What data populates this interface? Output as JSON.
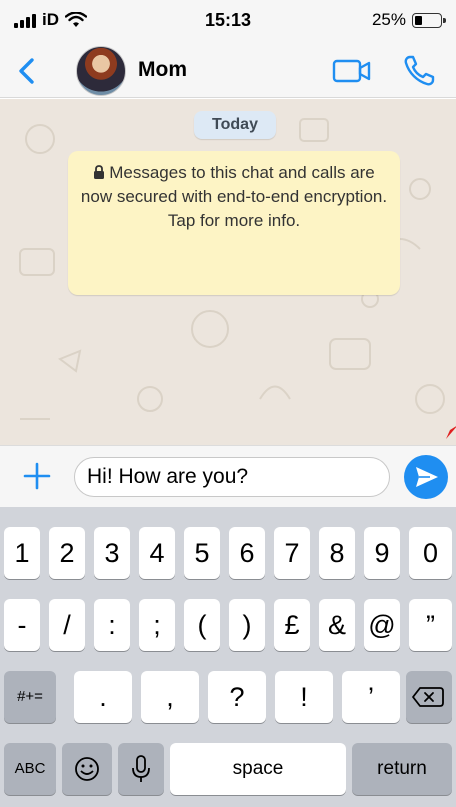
{
  "status_bar": {
    "carrier": "iD",
    "time": "15:13",
    "battery_percent": "25%",
    "battery_level": 0.25,
    "icons": [
      "signal-icon",
      "wifi-icon",
      "battery-icon"
    ]
  },
  "header": {
    "contact_name": "Mom",
    "icons": [
      "back-chevron-icon",
      "video-call-icon",
      "phone-icon"
    ],
    "accent_color": "#1f8ef1"
  },
  "chat": {
    "date_label": "Today",
    "encryption_notice": "Messages to this chat and calls are now secured with end-to-end encryption. Tap for more info.",
    "wallpaper_color": "#ece5dd",
    "notice_color": "#fdf4c5"
  },
  "composer": {
    "message_value": "Hi! How are you?",
    "icons": [
      "plus-icon",
      "send-icon"
    ]
  },
  "keyboard": {
    "row1": [
      "1",
      "2",
      "3",
      "4",
      "5",
      "6",
      "7",
      "8",
      "9",
      "0"
    ],
    "row2": [
      "-",
      "/",
      ":",
      ";",
      "(",
      ")",
      "£",
      "&",
      "@",
      "”"
    ],
    "row3_mode": "#+=",
    "row3_keys": [
      ".",
      ",",
      "?",
      "!",
      "’"
    ],
    "row4_abc": "ABC",
    "row4_space": "space",
    "row4_return": "return",
    "icons": [
      "delete-key-icon",
      "emoji-icon",
      "microphone-icon"
    ]
  }
}
